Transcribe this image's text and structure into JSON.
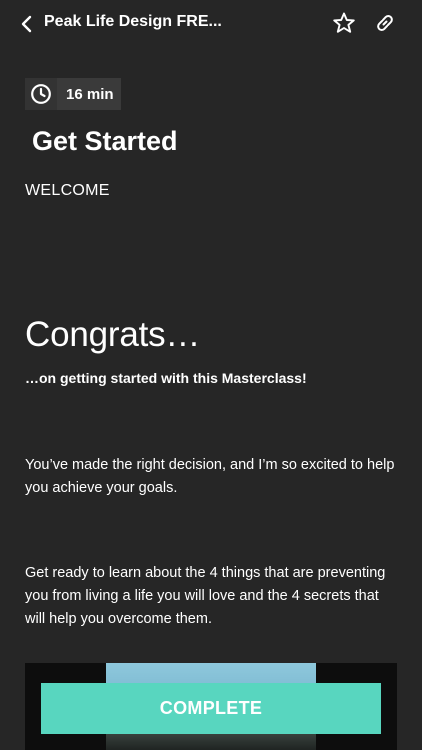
{
  "header": {
    "title": "Peak Life Design FRE...",
    "back_icon": "chevron-left-icon",
    "favorite_icon": "star-outline-icon",
    "share_icon": "link-icon"
  },
  "lesson": {
    "duration": "16 min",
    "duration_icon": "clock-icon",
    "section_title": "Get Started",
    "section_label": "WELCOME"
  },
  "content": {
    "heading": "Congrats…",
    "subheading": "…on getting started with this Masterclass!",
    "paragraph_1": "You’ve made the right decision, and I’m so excited to help you achieve your goals.",
    "paragraph_2": "Get ready to learn about the 4 things that are preventing you from living a life you will love and the 4 secrets that will help you overcome them."
  },
  "footer": {
    "complete_label": "COMPLETE"
  },
  "colors": {
    "background": "#262626",
    "accent": "#58d6bf",
    "badge": "#3a3a3a",
    "text": "#ffffff"
  }
}
